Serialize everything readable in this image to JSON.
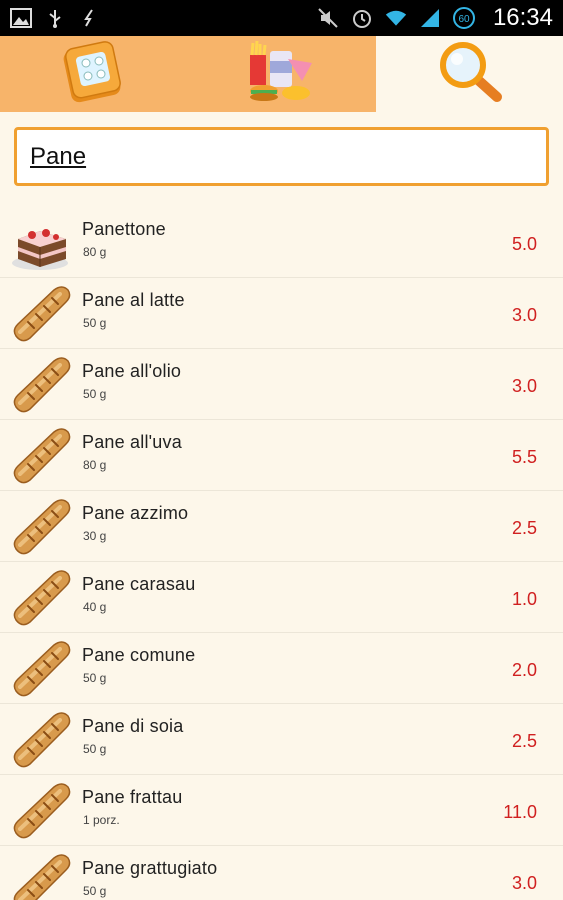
{
  "status_bar": {
    "time": "16:34",
    "left_icons": [
      "image-icon",
      "usb-icon",
      "debug-icon"
    ],
    "right_icons": [
      "mute-icon",
      "alarm-icon",
      "wifi-icon",
      "signal-icon",
      "battery-icon"
    ],
    "battery_text": "60"
  },
  "tabs": [
    {
      "name": "calculator-tab",
      "icon": "calculator-icon"
    },
    {
      "name": "food-tab",
      "icon": "fast-food-icon"
    },
    {
      "name": "search-tab",
      "icon": "magnifier-icon",
      "active": true
    }
  ],
  "search": {
    "value": "Pane"
  },
  "foods": [
    {
      "name": "Panettone",
      "qty": "80 g",
      "value": "5.0",
      "icon": "cake-icon"
    },
    {
      "name": "Pane al latte",
      "qty": "50 g",
      "value": "3.0",
      "icon": "bread-icon"
    },
    {
      "name": "Pane all'olio",
      "qty": "50 g",
      "value": "3.0",
      "icon": "bread-icon"
    },
    {
      "name": "Pane all'uva",
      "qty": "80 g",
      "value": "5.5",
      "icon": "bread-icon"
    },
    {
      "name": "Pane azzimo",
      "qty": "30 g",
      "value": "2.5",
      "icon": "bread-icon"
    },
    {
      "name": "Pane carasau",
      "qty": "40 g",
      "value": "1.0",
      "icon": "bread-icon"
    },
    {
      "name": "Pane comune",
      "qty": "50 g",
      "value": "2.0",
      "icon": "bread-icon"
    },
    {
      "name": "Pane di soia",
      "qty": "50 g",
      "value": "2.5",
      "icon": "bread-icon"
    },
    {
      "name": "Pane frattau",
      "qty": "1 porz.",
      "value": "11.0",
      "icon": "bread-icon"
    },
    {
      "name": "Pane grattugiato",
      "qty": "50 g",
      "value": "3.0",
      "icon": "bread-icon"
    }
  ],
  "colors": {
    "tab_orange": "#f7b46a",
    "search_border": "#f0a030",
    "value_red": "#d02020",
    "background": "#fdf7ea"
  }
}
